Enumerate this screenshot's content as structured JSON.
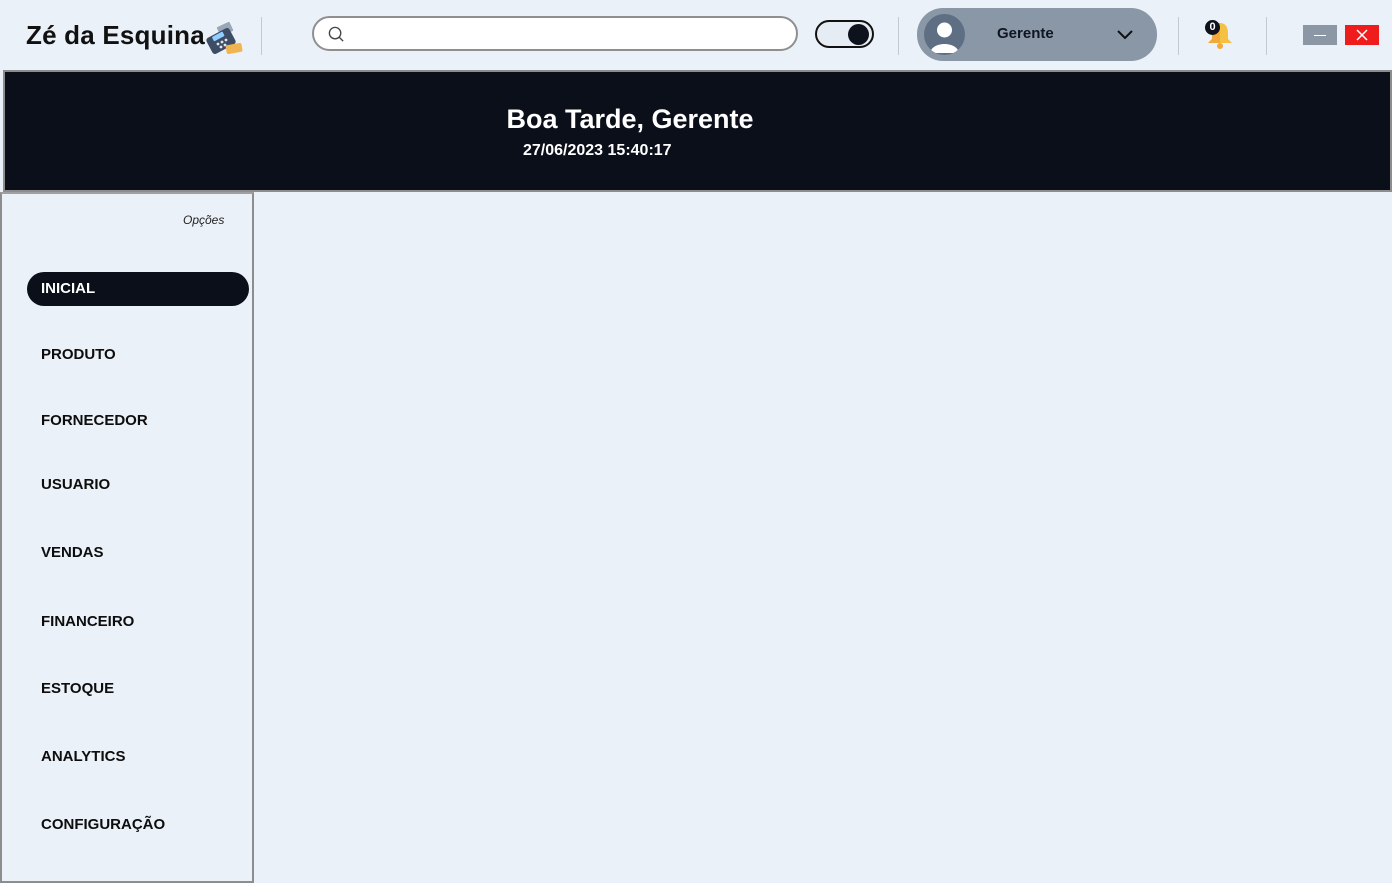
{
  "app": {
    "title": "Zé da Esquina"
  },
  "search": {
    "value": "",
    "placeholder": ""
  },
  "user": {
    "name": "Gerente"
  },
  "notifications": {
    "count": "0"
  },
  "banner": {
    "greeting": "Boa Tarde, Gerente",
    "datetime": "27/06/2023 15:40:17"
  },
  "sidebar": {
    "options_label": "Opções",
    "items": [
      {
        "label": "INICIAL",
        "active": true
      },
      {
        "label": "PRODUTO"
      },
      {
        "label": "FORNECEDOR"
      },
      {
        "label": "USUARIO"
      },
      {
        "label": "VENDAS"
      },
      {
        "label": "FINANCEIRO"
      },
      {
        "label": "ESTOQUE"
      },
      {
        "label": "ANALYTICS"
      },
      {
        "label": "CONFIGURAÇÃO"
      }
    ]
  },
  "colors": {
    "banner_bg": "#0b0f1a",
    "page_bg": "#ebf1f8",
    "user_pill": "#8a97a7",
    "close_button": "#ee1c1c"
  },
  "icons": [
    "credit-card-terminal-icon",
    "search-icon",
    "theme-toggle",
    "user-avatar-icon",
    "chevron-down-icon",
    "bell-icon",
    "minimize-icon",
    "close-icon"
  ]
}
